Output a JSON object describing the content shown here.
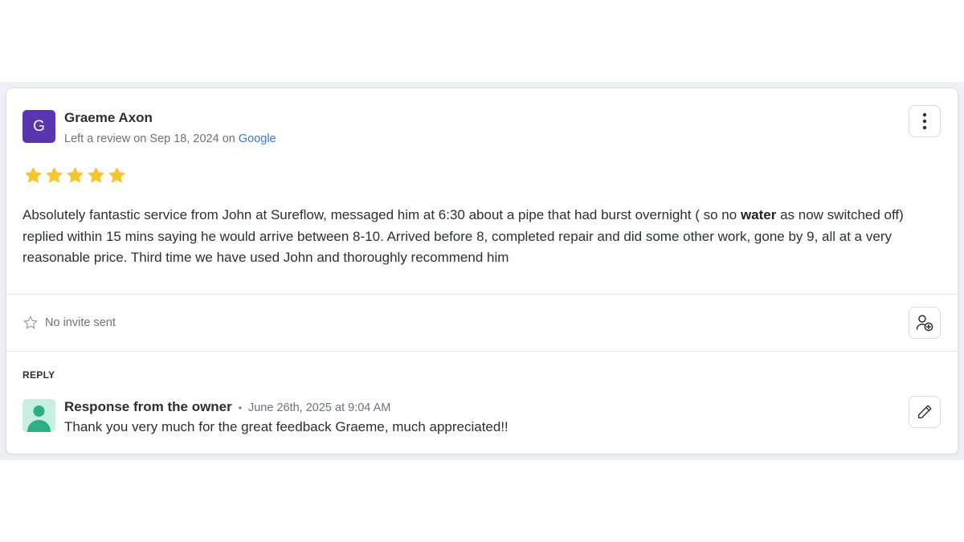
{
  "review": {
    "avatar_letter": "G",
    "avatar_color": "#5a35b0",
    "reviewer_name": "Graeme Axon",
    "meta_prefix": "Left a review on Sep 18, 2024 on ",
    "source": "Google",
    "rating": 5,
    "rating_max": 5,
    "star_color": "#f5c531",
    "text_before": "Absolutely fantastic service from John at Sureflow, messaged him at 6:30 about a pipe that had burst overnight ( so no ",
    "text_bold": "water",
    "text_after": " as now switched off) replied within 15 mins saying he would arrive between 8-10. Arrived before 8, completed repair and did some other work, gone by 9, all at a very reasonable price. Third time we have used John and thoroughly recommend him",
    "more_icon": "vertical-ellipsis-icon"
  },
  "invite": {
    "status": "No invite sent",
    "status_icon": "star-outline-icon",
    "action_icon": "add-user-icon"
  },
  "reply": {
    "heading": "REPLY",
    "owner_title": "Response from the owner",
    "separator": "•",
    "date": "June 26th, 2025 at 9:04 AM",
    "text": "Thank you very much for the great feedback Graeme, much appreciated!!",
    "owner_avatar_icon": "person-icon",
    "owner_avatar_color": "#2fae86",
    "edit_icon": "pencil-icon"
  }
}
